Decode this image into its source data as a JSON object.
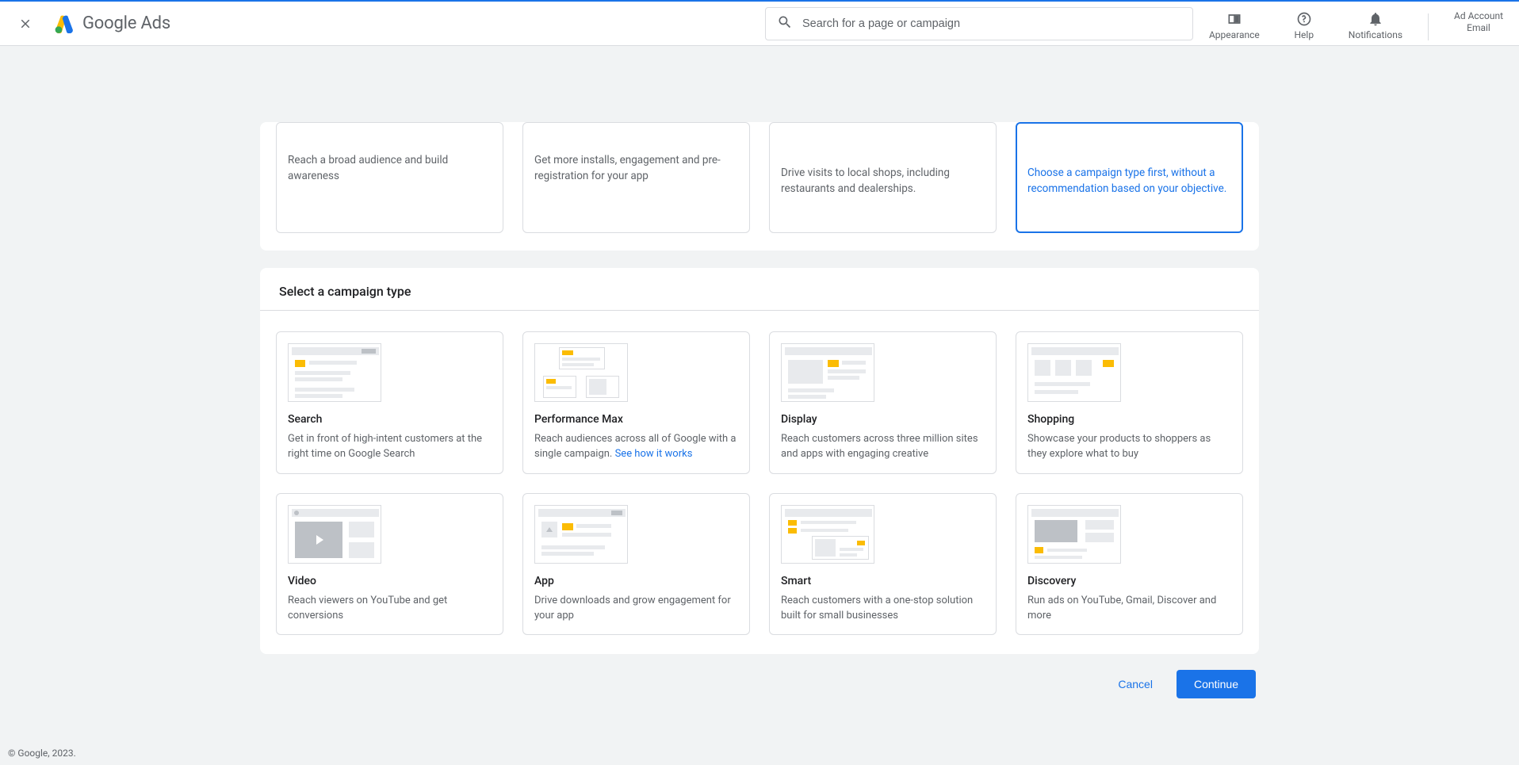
{
  "header": {
    "brand_a": "Google",
    "brand_b": "Ads",
    "search_placeholder": "Search for a page or campaign",
    "actions": {
      "appearance": "Appearance",
      "help": "Help",
      "notifications": "Notifications"
    },
    "account": {
      "line1": "Ad Account",
      "line2": "Email"
    }
  },
  "objectives": {
    "cards": [
      {
        "desc_visible": "Reach a broad audience and build awareness"
      },
      {
        "desc_visible": "Get more installs, engagement and pre-registration for your app"
      },
      {
        "desc_visible": "Drive visits to local shops, including restaurants and dealerships."
      },
      {
        "desc_visible": "Choose a campaign type first, without a recommendation based on your objective.",
        "selected": true
      }
    ]
  },
  "campaign_type": {
    "title": "Select a campaign type",
    "cards": [
      {
        "id": "search",
        "title": "Search",
        "desc": "Get in front of high-intent customers at the right time on Google Search"
      },
      {
        "id": "pmax",
        "title": "Performance Max",
        "desc": "Reach audiences across all of Google with a single campaign. ",
        "link": "See how it works"
      },
      {
        "id": "display",
        "title": "Display",
        "desc": "Reach customers across three million sites and apps with engaging creative"
      },
      {
        "id": "shopping",
        "title": "Shopping",
        "desc": "Showcase your products to shoppers as they explore what to buy"
      },
      {
        "id": "video",
        "title": "Video",
        "desc": "Reach viewers on YouTube and get conversions"
      },
      {
        "id": "app",
        "title": "App",
        "desc": "Drive downloads and grow engagement for your app"
      },
      {
        "id": "smart",
        "title": "Smart",
        "desc": "Reach customers with a one-stop solution built for small businesses"
      },
      {
        "id": "discovery",
        "title": "Discovery",
        "desc": "Run ads on YouTube, Gmail, Discover and more"
      }
    ]
  },
  "footer_actions": {
    "cancel": "Cancel",
    "continue": "Continue"
  },
  "page_footer": "© Google, 2023."
}
